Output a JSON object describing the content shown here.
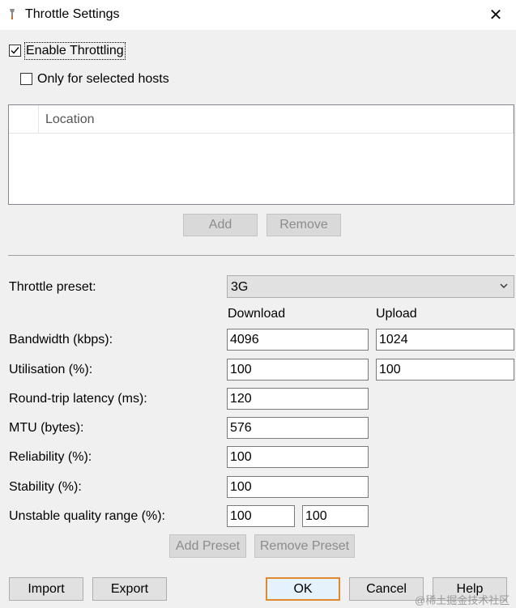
{
  "window": {
    "title": "Throttle Settings"
  },
  "options": {
    "enable_throttling": {
      "label": "Enable Throttling",
      "checked": true
    },
    "only_selected_hosts": {
      "label": "Only for selected hosts",
      "checked": false
    }
  },
  "hosts_table": {
    "column": "Location"
  },
  "hosts_buttons": {
    "add": "Add",
    "remove": "Remove"
  },
  "preset": {
    "label": "Throttle preset:",
    "value": "3G"
  },
  "columns": {
    "download": "Download",
    "upload": "Upload"
  },
  "fields": {
    "bandwidth": {
      "label": "Bandwidth (kbps):",
      "download": "4096",
      "upload": "1024"
    },
    "utilisation": {
      "label": "Utilisation (%):",
      "download": "100",
      "upload": "100"
    },
    "latency": {
      "label": "Round-trip latency (ms):",
      "value": "120"
    },
    "mtu": {
      "label": "MTU (bytes):",
      "value": "576"
    },
    "reliability": {
      "label": "Reliability (%):",
      "value": "100"
    },
    "stability": {
      "label": "Stability (%):",
      "value": "100"
    },
    "unstable_range": {
      "label": "Unstable quality range (%):",
      "min": "100",
      "max": "100"
    }
  },
  "preset_buttons": {
    "add": "Add Preset",
    "remove": "Remove Preset"
  },
  "footer": {
    "import": "Import",
    "export": "Export",
    "ok": "OK",
    "cancel": "Cancel",
    "help": "Help"
  },
  "watermark": "@稀土掘金技术社区",
  "icons": {
    "title": "wrench-icon",
    "close": "close-icon",
    "check": "checkmark-icon",
    "dropdown": "chevron-down-icon"
  }
}
